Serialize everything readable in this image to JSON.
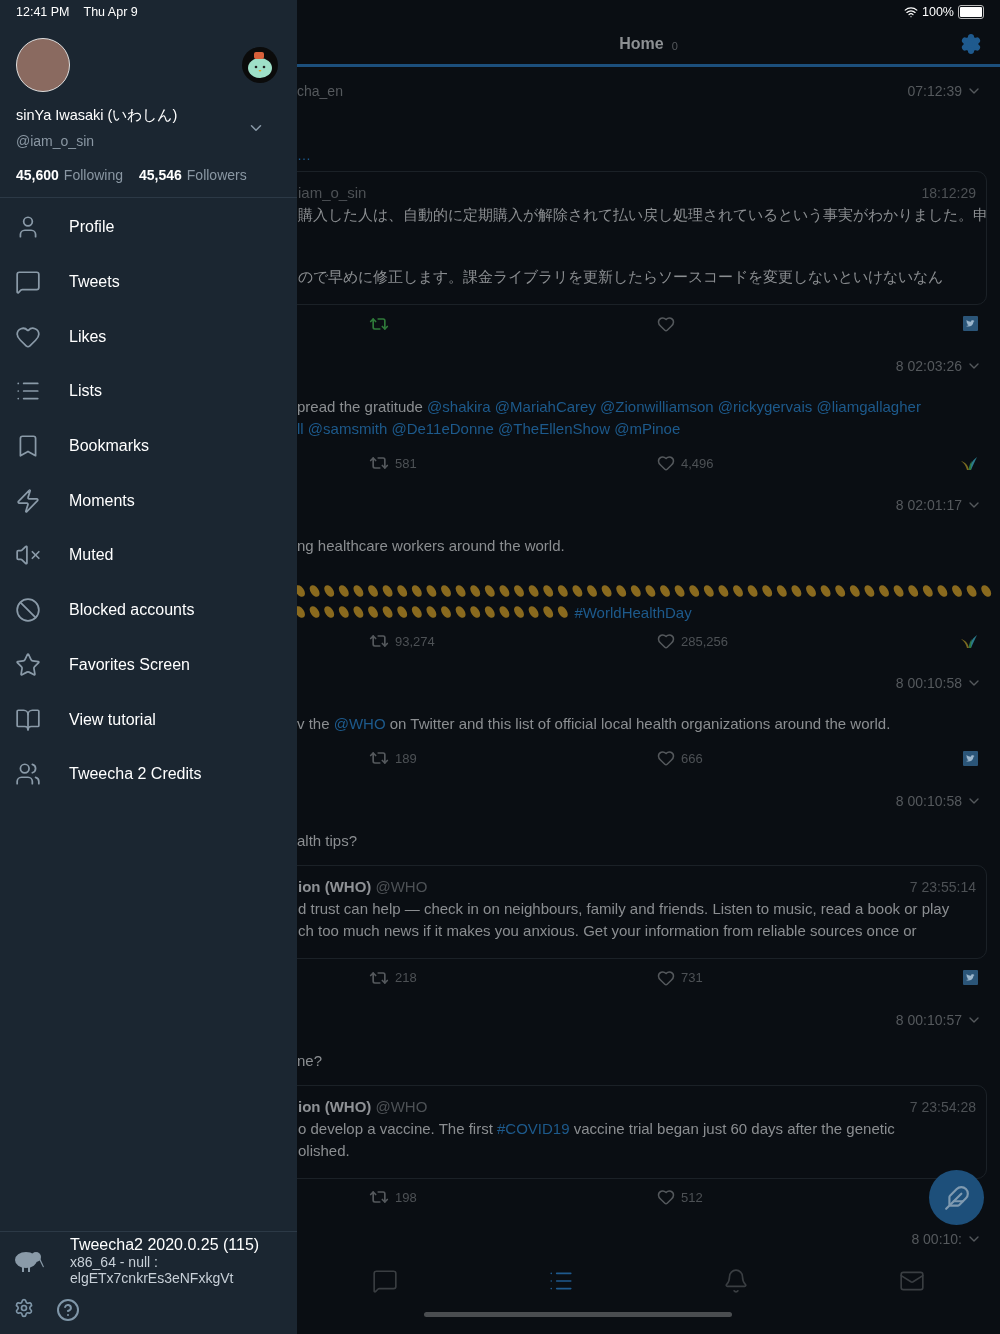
{
  "status_bar": {
    "time": "12:41 PM",
    "date": "Thu Apr 9",
    "battery": "100%"
  },
  "drawer": {
    "name": "sinYa Iwasaki (いわしん)",
    "handle": "@iam_o_sin",
    "following_count": "45,600",
    "following_label": "Following",
    "followers_count": "45,546",
    "followers_label": "Followers",
    "menu": [
      {
        "label": "Profile"
      },
      {
        "label": "Tweets"
      },
      {
        "label": "Likes"
      },
      {
        "label": "Lists"
      },
      {
        "label": "Bookmarks"
      },
      {
        "label": "Moments"
      },
      {
        "label": "Muted"
      },
      {
        "label": "Blocked accounts"
      },
      {
        "label": "Favorites Screen"
      },
      {
        "label": "View tutorial"
      },
      {
        "label": "Tweecha 2 Credits"
      }
    ],
    "app_version": "Tweecha2 2020.0.25 (115)",
    "build_line": "x86_64 - null :",
    "build_id": "elgETx7cnkrEs3eNFxkgVt"
  },
  "header": {
    "title": "Home",
    "count": "0"
  },
  "timeline": [
    {
      "kind": "meta",
      "author": "cha_en",
      "time": "07:12:39"
    },
    {
      "kind": "more",
      "text": "…"
    },
    {
      "kind": "quote",
      "handle": "iam_o_sin",
      "time": "18:12:29",
      "paragraphs": [
        [
          [
            {
              "text": "購入した人は、自動的に定期購入が解除されて払い戻し処理されているという事実がわかりました。申",
              "link": false
            }
          ]
        ],
        [
          [
            {
              "text": "ので早めに修正します。課金ライブラリを更新したらソースコードを変更しないといけないなん",
              "link": false
            }
          ]
        ]
      ]
    },
    {
      "kind": "actions",
      "retweeted": true,
      "badge": {
        "kind": "twitter"
      }
    },
    {
      "kind": "meta",
      "time": "8 02:03:26"
    },
    {
      "kind": "text",
      "lines": [
        [
          {
            "text": "pread the gratitude ",
            "link": false
          },
          {
            "text": "@shakira @MariahCarey @Zionwilliamson @rickygervais @liamgallagher",
            "link": true
          }
        ],
        [
          {
            "text": "ll @samsmith @De11eDonne @TheEllenShow @mPinoe",
            "link": true
          }
        ]
      ]
    },
    {
      "kind": "actions",
      "retweeted": false,
      "retweets": "581",
      "likes": "4,496",
      "badge": {
        "kind": "leaf"
      }
    },
    {
      "kind": "meta",
      "time": "8 02:01:17"
    },
    {
      "kind": "text",
      "lines": [
        [
          {
            "text": "ng healthcare workers around the world.",
            "link": false
          }
        ]
      ]
    },
    {
      "kind": "claps"
    },
    {
      "kind": "claps",
      "trailing": "#WorldHealthDay"
    },
    {
      "kind": "actions",
      "retweeted": false,
      "retweets": "93,274",
      "likes": "285,256",
      "badge": {
        "kind": "leaf"
      }
    },
    {
      "kind": "meta",
      "time": "8 00:10:58"
    },
    {
      "kind": "text",
      "lines": [
        [
          {
            "text": "v the ",
            "link": false
          },
          {
            "text": "@WHO",
            "link": true
          },
          {
            "text": " on Twitter and this list of official local health organizations around the world.",
            "link": false
          }
        ]
      ]
    },
    {
      "kind": "actions",
      "retweeted": false,
      "retweets": "189",
      "likes": "666",
      "badge": {
        "kind": "twitter"
      }
    },
    {
      "kind": "meta",
      "time": "8 00:10:58"
    },
    {
      "kind": "text",
      "lines": [
        [
          {
            "text": "alth tips?",
            "link": false
          }
        ]
      ]
    },
    {
      "kind": "quote",
      "author": "ion (WHO)",
      "handle": "@WHO",
      "time": "7 23:55:14",
      "paragraphs": [
        [
          [
            {
              "text": "d trust can help — check in on neighbours, family and friends. Listen to music, read a book or play",
              "link": false
            }
          ],
          [
            {
              "text": "ch too much news if it makes you anxious. Get your information from reliable sources once or",
              "link": false
            }
          ]
        ]
      ]
    },
    {
      "kind": "actions",
      "retweeted": false,
      "retweets": "218",
      "likes": "731",
      "badge": {
        "kind": "twitter"
      }
    },
    {
      "kind": "meta",
      "time": "8 00:10:57"
    },
    {
      "kind": "text",
      "lines": [
        [
          {
            "text": "ne?",
            "link": false
          }
        ]
      ]
    },
    {
      "kind": "quote",
      "author": "ion (WHO)",
      "handle": "@WHO",
      "time": "7 23:54:28",
      "paragraphs": [
        [
          [
            {
              "text": "o develop a vaccine. The first ",
              "link": false
            },
            {
              "text": "#COVID19",
              "link": true
            },
            {
              "text": " vaccine trial began just 60 days after the genetic",
              "link": false
            }
          ],
          [
            {
              "text": "olished.",
              "link": false
            }
          ]
        ]
      ]
    },
    {
      "kind": "actions",
      "retweeted": false,
      "retweets": "198",
      "likes": "512"
    },
    {
      "kind": "meta",
      "time": "8 00:10:"
    }
  ],
  "tab_bar": [
    {
      "selected": false
    },
    {
      "selected": true
    },
    {
      "selected": false
    },
    {
      "selected": false
    }
  ]
}
